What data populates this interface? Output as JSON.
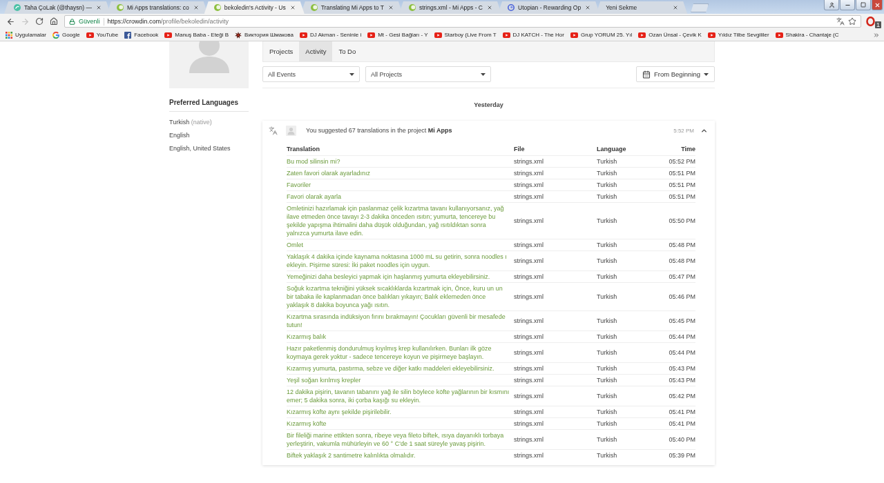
{
  "browser": {
    "tabs": [
      {
        "title": "Taha ÇoLak (@thaysn) —",
        "selected": false,
        "kind": "round"
      },
      {
        "title": "Mi Apps translations: co",
        "selected": false,
        "kind": "crescent"
      },
      {
        "title": "bekoledin's Activity - Us",
        "selected": true,
        "kind": "crescent"
      },
      {
        "title": "Translating Mi Apps to T",
        "selected": false,
        "kind": "crescent"
      },
      {
        "title": "strings.xml - Mi Apps - C",
        "selected": false,
        "kind": "crescent"
      },
      {
        "title": "Utopian - Rewarding Op",
        "selected": false,
        "kind": "swirl"
      },
      {
        "title": "Yeni Sekme",
        "selected": false,
        "kind": "none"
      }
    ],
    "nav_buttons": [
      {
        "kind": "back",
        "disabled": false
      },
      {
        "kind": "forward",
        "disabled": true
      },
      {
        "kind": "reload",
        "disabled": false
      },
      {
        "kind": "home",
        "disabled": false
      }
    ],
    "address": {
      "secure_label": "Güvenli",
      "url_host": "https://crowdin.com",
      "url_path": "/profile/bekoledin/activity"
    },
    "extension_badge": "1",
    "bookmarks": [
      {
        "label": "Uygulamalar",
        "kind": "apps"
      },
      {
        "label": "Google",
        "kind": "g"
      },
      {
        "label": "YouTube",
        "kind": "video"
      },
      {
        "label": "Facebook",
        "kind": "square"
      },
      {
        "label": "Manuş Baba - Eteği B",
        "kind": "video"
      },
      {
        "label": "Виктория Шмакова",
        "kind": "star"
      },
      {
        "label": "DJ Akman - Seninle i",
        "kind": "video"
      },
      {
        "label": "Mt - Gesi Bağları - Y",
        "kind": "video"
      },
      {
        "label": "Starboy (Live From T",
        "kind": "video"
      },
      {
        "label": "DJ KATCH - The Hor",
        "kind": "video"
      },
      {
        "label": "Grup YORUM 25. Yıl",
        "kind": "video"
      },
      {
        "label": "Ozan Ünsal - Çevik K",
        "kind": "video"
      },
      {
        "label": "Yıldız Tilbe Sevgililer",
        "kind": "video"
      },
      {
        "label": "Shakira - Chantaje (C",
        "kind": "video"
      }
    ]
  },
  "sidebar": {
    "heading": "Preferred Languages",
    "languages": [
      {
        "name": "Turkish",
        "note": "(native)"
      },
      {
        "name": "English"
      },
      {
        "name": "English, United States"
      }
    ]
  },
  "profile_tabs": [
    {
      "label": "Projects",
      "selected": false
    },
    {
      "label": "Activity",
      "selected": true
    },
    {
      "label": "To Do",
      "selected": false
    }
  ],
  "filters": [
    {
      "value": "All Events"
    },
    {
      "value": "All Projects"
    }
  ],
  "date_filter": "From Beginning",
  "day_heading": "Yesterday",
  "activity": {
    "summary": "You suggested 67 translations in the project **Mi Apps**",
    "time": "5:52 PM",
    "expanded": true,
    "columns": [
      "Translation",
      "File",
      "Language",
      "Time"
    ],
    "rows": [
      {
        "translation": "Bu mod silinsin mi?",
        "file": "strings.xml",
        "language": "Turkish",
        "time": "05:52 PM"
      },
      {
        "translation": "Zaten favori olarak ayarladınız",
        "file": "strings.xml",
        "language": "Turkish",
        "time": "05:51 PM"
      },
      {
        "translation": "Favoriler",
        "file": "strings.xml",
        "language": "Turkish",
        "time": "05:51 PM"
      },
      {
        "translation": "Favori olarak ayarla",
        "file": "strings.xml",
        "language": "Turkish",
        "time": "05:51 PM"
      },
      {
        "translation": "Omletinizi hazırlamak için paslanmaz çelik kızartma tavanı kullanıyorsanız, yağ ilave etmeden önce tavayı 2-3 dakika önceden ısıtın; yumurta, tencereye bu şekilde yapışma ihtimalini daha düşük olduğundan, yağ ısıtıldıktan sonra yalnızca yumurta ilave edin.",
        "file": "strings.xml",
        "language": "Turkish",
        "time": "05:50 PM"
      },
      {
        "translation": "Omlet",
        "file": "strings.xml",
        "language": "Turkish",
        "time": "05:48 PM"
      },
      {
        "translation": "Yaklaşık 4 dakika içinde kaynama noktasına 1000 mL su getirin, sonra noodles ı ekleyin. Pişirme süresi: İki paket noodles için uygun.",
        "file": "strings.xml",
        "language": "Turkish",
        "time": "05:48 PM"
      },
      {
        "translation": "Yemeğinizi daha besleyici yapmak için haşlanmış yumurta ekleyebilirsiniz.",
        "file": "strings.xml",
        "language": "Turkish",
        "time": "05:47 PM"
      },
      {
        "translation": "Soğuk kızartma tekniğini yüksek sıcaklıklarda kızartmak için, Önce, kuru un un bir tabaka ile kaplanmadan önce balıkları yıkayın; Balık eklemeden önce yaklaşık 8 dakika boyunca yağı ısıtın.",
        "file": "strings.xml",
        "language": "Turkish",
        "time": "05:46 PM"
      },
      {
        "translation": "Kızartma sırasında indüksiyon fırını bırakmayın! Çocukları güvenli bir mesafede tutun!",
        "file": "strings.xml",
        "language": "Turkish",
        "time": "05:45 PM"
      },
      {
        "translation": "Kızarmış balık",
        "file": "strings.xml",
        "language": "Turkish",
        "time": "05:44 PM"
      },
      {
        "translation": "Hazır paketlenmiş dondurulmuş kıyılmış krep kullanılırken. Bunları ilk göze koymaya gerek yoktur - sadece tencereye koyun ve pişirmeye başlayın.",
        "file": "strings.xml",
        "language": "Turkish",
        "time": "05:44 PM"
      },
      {
        "translation": "Kızarmış yumurta, pastırma, sebze ve diğer katkı maddeleri ekleyebilirsiniz.",
        "file": "strings.xml",
        "language": "Turkish",
        "time": "05:43 PM"
      },
      {
        "translation": "Yeşil soğan kırılmış krepler",
        "file": "strings.xml",
        "language": "Turkish",
        "time": "05:43 PM"
      },
      {
        "translation": "12 dakika pişirin, tavanın tabanını yağ ile silin böylece köfte yağlarının bir kısmını emer; 5 dakika sonra, iki çorba kaşığı su ekleyin.",
        "file": "strings.xml",
        "language": "Turkish",
        "time": "05:42 PM"
      },
      {
        "translation": "Kızarmış köfte aynı şekilde pişirilebilir.",
        "file": "strings.xml",
        "language": "Turkish",
        "time": "05:41 PM"
      },
      {
        "translation": "Kızarmış köfte",
        "file": "strings.xml",
        "language": "Turkish",
        "time": "05:41 PM"
      },
      {
        "translation": "Bir fileliği marine ettikten sonra, ribeye veya fileto biftek, ısıya dayanıklı torbaya yerleştirin, vakumla mühürleyin ve 60 ° C'de 1 saat süreyle yavaş pişirin.",
        "file": "strings.xml",
        "language": "Turkish",
        "time": "05:40 PM"
      },
      {
        "translation": "Biftek yaklaşık 2 santimetre kalınlıkta olmalıdır.",
        "file": "strings.xml",
        "language": "Turkish",
        "time": "05:39 PM"
      }
    ]
  }
}
